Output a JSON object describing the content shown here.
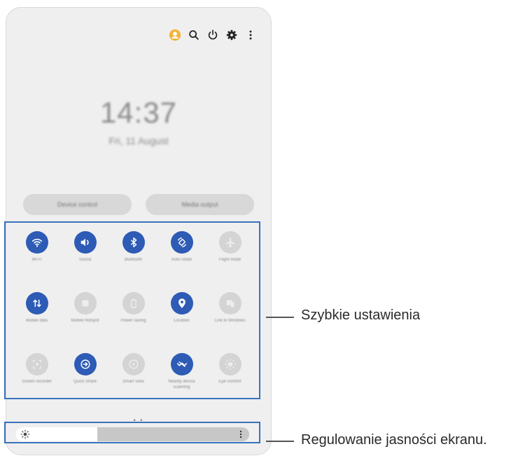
{
  "panel": {
    "top_icons": [
      "avatar-icon",
      "search-icon",
      "power-icon",
      "gear-icon",
      "more-vertical-icon"
    ],
    "clock_time": "14:37",
    "clock_date": "Fri, 11 August",
    "buttons": {
      "device_control": "Device control",
      "media_output": "Media output"
    },
    "tiles": [
      {
        "label": "Wi-Fi",
        "icon": "wifi-icon",
        "active": true
      },
      {
        "label": "Sound",
        "icon": "sound-icon",
        "active": true
      },
      {
        "label": "Bluetooth",
        "icon": "bluetooth-icon",
        "active": true
      },
      {
        "label": "Auto rotate",
        "icon": "auto-rotate-icon",
        "active": true
      },
      {
        "label": "Flight mode",
        "icon": "airplane-icon",
        "active": false
      },
      {
        "label": "Mobile data",
        "icon": "mobile-data-icon",
        "active": true
      },
      {
        "label": "Mobile Hotspot",
        "icon": "hotspot-icon",
        "active": false
      },
      {
        "label": "Power saving",
        "icon": "battery-icon",
        "active": false
      },
      {
        "label": "Location",
        "icon": "location-icon",
        "active": true
      },
      {
        "label": "Link to Windows",
        "icon": "link-windows-icon",
        "active": false
      },
      {
        "label": "Screen recorder",
        "icon": "screen-recorder-icon",
        "active": false
      },
      {
        "label": "Quick Share",
        "icon": "quick-share-icon",
        "active": true
      },
      {
        "label": "Smart View",
        "icon": "smart-view-icon",
        "active": false
      },
      {
        "label": "Nearby device scanning",
        "icon": "nearby-scan-icon",
        "active": true
      },
      {
        "label": "Eye comfort",
        "icon": "eye-comfort-icon",
        "active": false
      }
    ],
    "page_indicator": "• •",
    "brightness": {
      "level": 0.35,
      "icon": "sun-icon",
      "menu_icon": "more-vertical-icon"
    }
  },
  "callouts": {
    "quick_settings": "Szybkie ustawienia",
    "brightness": "Regulowanie jasności ekranu."
  },
  "colors": {
    "active": "#2d5bb5",
    "inactive": "#d4d4d4",
    "frame": "#3a72bd"
  }
}
